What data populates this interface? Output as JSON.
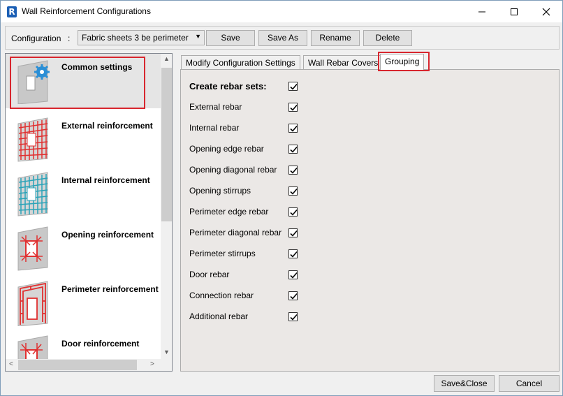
{
  "window": {
    "title": "Wall Reinforcement Configurations",
    "app_icon_letter": "R"
  },
  "config": {
    "label": "Configuration",
    "colon": ":",
    "selected": "Fabric sheets 3 be perimeter",
    "buttons": {
      "save": "Save",
      "save_as": "Save As",
      "rename": "Rename",
      "delete": "Delete"
    }
  },
  "sidebar": {
    "items": [
      {
        "label": "Common settings",
        "icon": "common-settings-icon",
        "selected": true
      },
      {
        "label": "External reinforcement",
        "icon": "external-reinforcement-icon"
      },
      {
        "label": "Internal reinforcement",
        "icon": "internal-reinforcement-icon"
      },
      {
        "label": "Opening reinforcement",
        "icon": "opening-reinforcement-icon"
      },
      {
        "label": "Perimeter reinforcement",
        "icon": "perimeter-reinforcement-icon"
      },
      {
        "label": "Door reinforcement",
        "icon": "door-reinforcement-icon"
      }
    ]
  },
  "tabs": [
    {
      "label": "Modify Configuration Settings"
    },
    {
      "label": "Wall Rebar Covers"
    },
    {
      "label": "Grouping",
      "active": true
    }
  ],
  "grouping": {
    "title": "Create rebar sets:",
    "title_checked": true,
    "options": [
      {
        "label": "External rebar",
        "checked": true
      },
      {
        "label": "Internal rebar",
        "checked": true
      },
      {
        "label": "Opening edge rebar",
        "checked": true
      },
      {
        "label": "Opening diagonal rebar",
        "checked": true
      },
      {
        "label": "Opening stirrups",
        "checked": true
      },
      {
        "label": "Perimeter edge rebar",
        "checked": true
      },
      {
        "label": "Perimeter diagonal rebar",
        "checked": true
      },
      {
        "label": "Perimeter stirrups",
        "checked": true
      },
      {
        "label": "Door rebar",
        "checked": true
      },
      {
        "label": "Connection rebar",
        "checked": true
      },
      {
        "label": "Additional rebar",
        "checked": true
      }
    ]
  },
  "footer": {
    "save_close": "Save&Close",
    "cancel": "Cancel"
  },
  "colors": {
    "highlight": "#d8262e",
    "rebar_red": "#e03030",
    "rebar_teal": "#2aa3b8",
    "panel_bg": "#ebe8e6"
  }
}
